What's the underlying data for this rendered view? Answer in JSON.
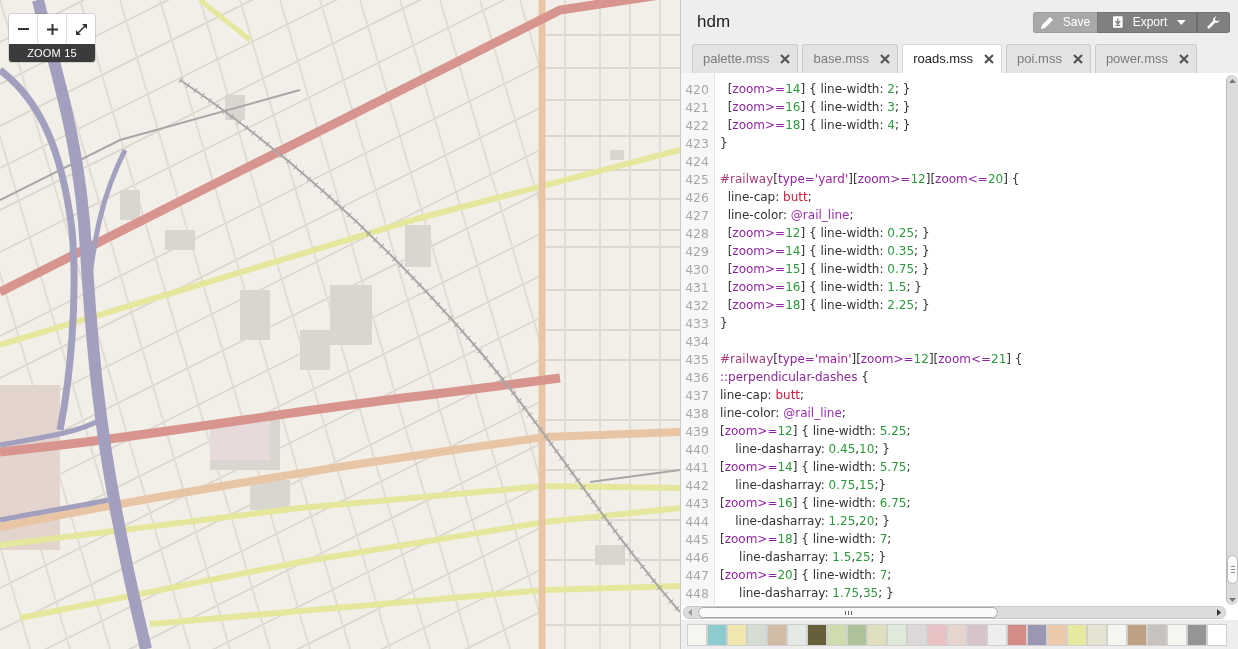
{
  "map": {
    "zoom_buttons": [
      {
        "kind": "zoom-out"
      },
      {
        "kind": "zoom-in"
      },
      {
        "kind": "fullscreen"
      }
    ],
    "zoom_label": "ZOOM 15"
  },
  "project": {
    "title": "hdm"
  },
  "toolbar": [
    {
      "kind": "save",
      "label": "Save",
      "disabled": true
    },
    {
      "kind": "export",
      "label": "Export",
      "disabled": false
    },
    {
      "kind": "settings",
      "disabled": false
    }
  ],
  "tabs": [
    {
      "label": "palette.mss",
      "selected": false
    },
    {
      "label": "base.mss",
      "selected": false
    },
    {
      "label": "roads.mss",
      "selected": true
    },
    {
      "label": "poi.mss",
      "selected": false
    },
    {
      "label": "power.mss",
      "selected": false
    }
  ],
  "editor": {
    "lines": [
      {
        "number": "420",
        "text": "  [zoom>=14] { line-width: 2; }"
      },
      {
        "number": "421",
        "text": "  [zoom>=16] { line-width: 3; }"
      },
      {
        "number": "422",
        "text": "  [zoom>=18] { line-width: 4; }"
      },
      {
        "number": "423",
        "text": "}"
      },
      {
        "number": "424"
      },
      {
        "number": "425",
        "text": "#railway[type='yard'][zoom>=12][zoom<=20] {"
      },
      {
        "number": "426",
        "text": "  line-cap: butt;"
      },
      {
        "number": "427",
        "text": "  line-color: @rail_line;"
      },
      {
        "number": "428",
        "text": "  [zoom>=12] { line-width: 0.25; }"
      },
      {
        "number": "429",
        "text": "  [zoom>=14] { line-width: 0.35; }"
      },
      {
        "number": "430",
        "text": "  [zoom>=15] { line-width: 0.75; }"
      },
      {
        "number": "431",
        "text": "  [zoom>=16] { line-width: 1.5; }"
      },
      {
        "number": "432",
        "text": "  [zoom>=18] { line-width: 2.25; }"
      },
      {
        "number": "433",
        "text": "}"
      },
      {
        "number": "434"
      },
      {
        "number": "435",
        "text": "#railway[type='main'][zoom>=12][zoom<=21] {"
      },
      {
        "number": "436",
        "text": "::perpendicular-dashes {"
      },
      {
        "number": "437",
        "text": "line-cap: butt;"
      },
      {
        "number": "438",
        "text": "line-color: @rail_line;"
      },
      {
        "number": "439",
        "text": "[zoom>=12] { line-width: 5.25;"
      },
      {
        "number": "440",
        "text": "    line-dasharray: 0.45,10; }"
      },
      {
        "number": "441",
        "text": "[zoom>=14] { line-width: 5.75;"
      },
      {
        "number": "442",
        "text": "    line-dasharray: 0.75,15;}"
      },
      {
        "number": "443",
        "text": "[zoom>=16] { line-width: 6.75;"
      },
      {
        "number": "444",
        "text": "    line-dasharray: 1.25,20; }"
      },
      {
        "number": "445",
        "text": "[zoom>=18] { line-width: 7;"
      },
      {
        "number": "446",
        "text": "     line-dasharray: 1.5,25; }"
      },
      {
        "number": "447",
        "text": "[zoom>=20] { line-width: 7;"
      },
      {
        "number": "448",
        "text": "     line-dasharray: 1.75,35; }"
      }
    ]
  },
  "palette": [
    {
      "color": "#f6f5ef"
    },
    {
      "color": "#8ccccf"
    },
    {
      "color": "#f0e6b0"
    },
    {
      "color": "#d5ddd3"
    },
    {
      "color": "#d2bba5"
    },
    {
      "color": "#e4e9e3"
    },
    {
      "color": "#665f3a"
    },
    {
      "color": "#cfdcae"
    },
    {
      "color": "#adc297"
    },
    {
      "color": "#e0dfbd"
    },
    {
      "color": "#e0eada"
    },
    {
      "color": "#dcd9d8"
    },
    {
      "color": "#e8c2c2"
    },
    {
      "color": "#e6d5cc"
    },
    {
      "color": "#d7c4c8"
    },
    {
      "color": "#eeeeee"
    },
    {
      "color": "#d38c88"
    },
    {
      "color": "#9b97b2"
    },
    {
      "color": "#ebc9a9"
    },
    {
      "color": "#e7ea9e"
    },
    {
      "color": "#e5e3d1"
    },
    {
      "color": "#f6f5f0"
    },
    {
      "color": "#bfa084"
    },
    {
      "color": "#c7c2bd"
    },
    {
      "color": "#f5f6f0"
    },
    {
      "color": "#959595"
    },
    {
      "color": "#ffffff"
    }
  ]
}
